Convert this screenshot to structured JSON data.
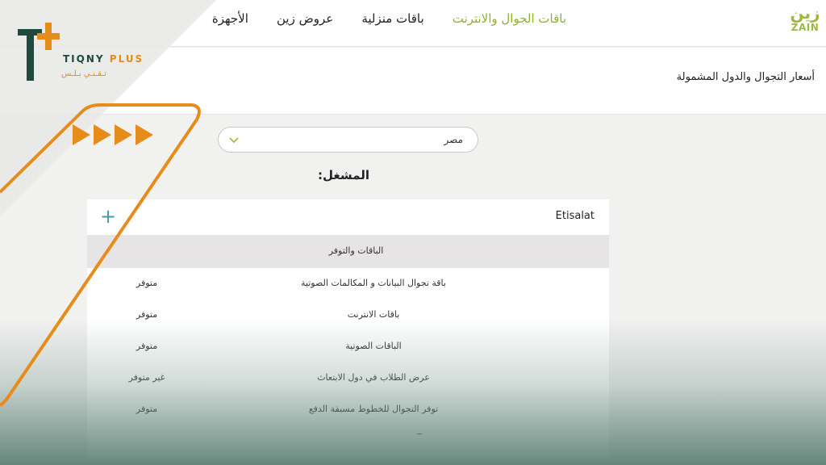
{
  "brand": {
    "logo_ar": "زين",
    "logo_en": "ZAIN",
    "accent": "#9cba3c"
  },
  "nav": {
    "items": [
      {
        "label": "باقات الجوال والانترنت",
        "active": true
      },
      {
        "label": "باقات منزلية"
      },
      {
        "label": "عروض زين"
      },
      {
        "label": "الأجهزة"
      }
    ]
  },
  "page": {
    "title": "أسعار التجوال والدول المشمولة"
  },
  "country_select": {
    "value": "مصر",
    "icon": "chevron-down-icon"
  },
  "operator": {
    "heading": "المشغل:",
    "name": "Etisalat",
    "expand_icon": "plus-icon",
    "plans_header": "الباقات والتوفر",
    "rows": [
      {
        "plan": "باقة تجوال البيانات و المكالمات الصوتية",
        "status": "متوفر"
      },
      {
        "plan": "باقات الانترنت",
        "status": "متوفر"
      },
      {
        "plan": "الباقات الصوتية",
        "status": "متوفر"
      },
      {
        "plan": "عرض الطلاب في دول الابتعاث",
        "status": "غير متوفر"
      },
      {
        "plan": "توفر التجوال للخطوط مسبقة الدفع",
        "status": "متوفر"
      }
    ]
  },
  "watermark": {
    "name_part1": "TIQNY",
    "name_part2": "PLUS",
    "arabic": "تـقـنـي بـلـس",
    "primary_color": "#1d4a3c",
    "accent_color": "#e58c1a"
  }
}
